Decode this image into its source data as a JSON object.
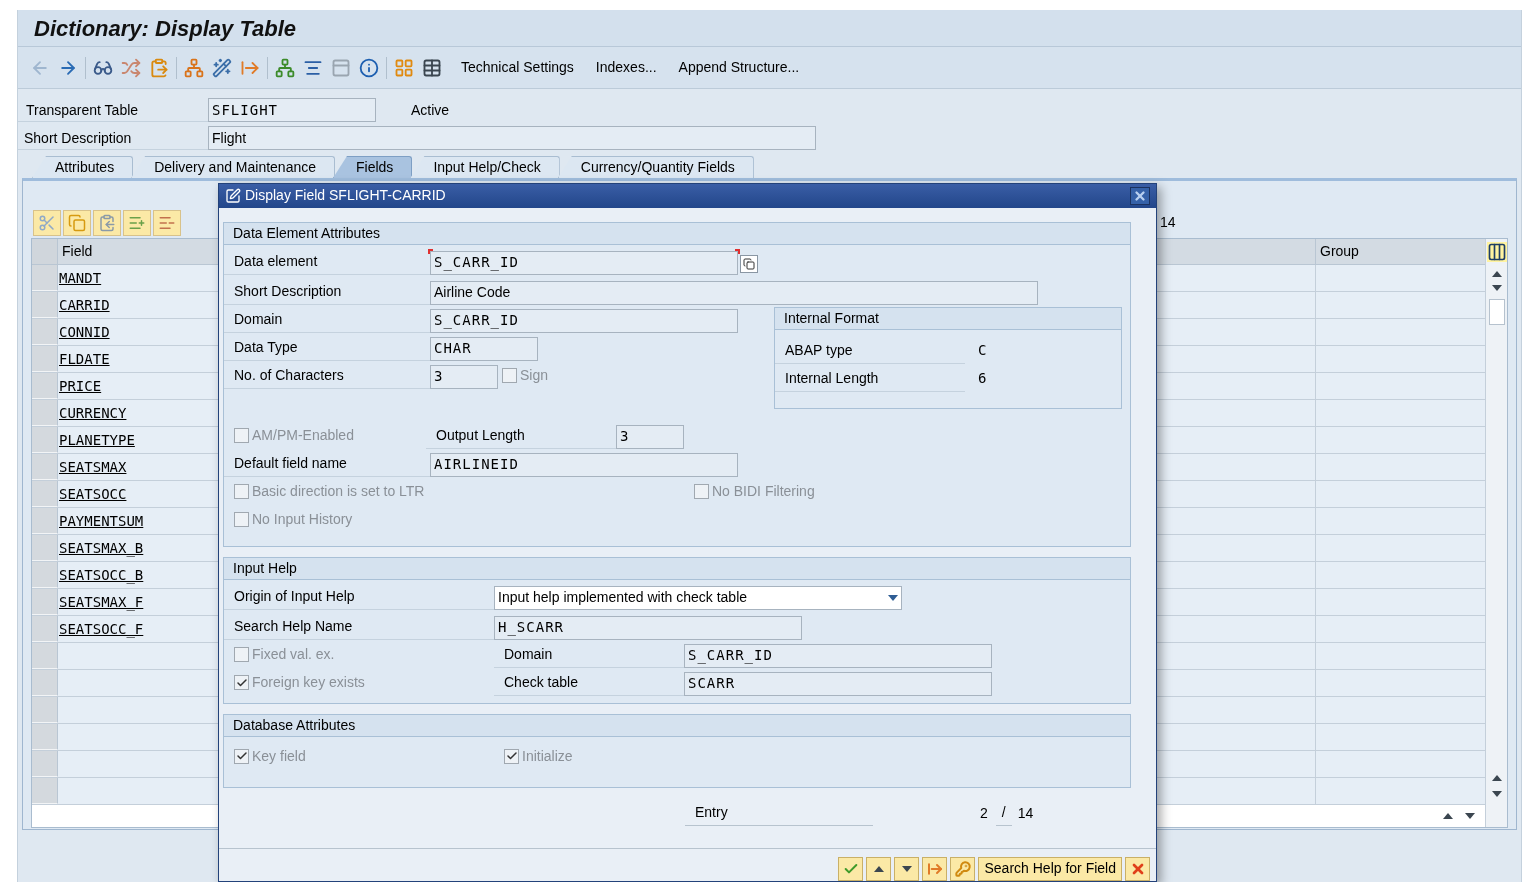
{
  "window": {
    "title": "Dictionary: Display Table"
  },
  "toolbar": {
    "buttons": [
      "Technical Settings",
      "Indexes...",
      "Append Structure..."
    ]
  },
  "header": {
    "table_label": "Transparent Table",
    "table_name": "SFLIGHT",
    "status": "Active",
    "description_label": "Short Description",
    "description": "Flight"
  },
  "tabs": [
    {
      "label": "Attributes",
      "selected": false
    },
    {
      "label": "Delivery and Maintenance",
      "selected": false
    },
    {
      "label": "Fields",
      "selected": true
    },
    {
      "label": "Input Help/Check",
      "selected": false
    },
    {
      "label": "Currency/Quantity Fields",
      "selected": false
    }
  ],
  "fields_table": {
    "entry_total": "14",
    "columns": [
      "Field",
      "Group"
    ],
    "rows": [
      "MANDT",
      "CARRID",
      "CONNID",
      "FLDATE",
      "PRICE",
      "CURRENCY",
      "PLANETYPE",
      "SEATSMAX",
      "SEATSOCC",
      "PAYMENTSUM",
      "SEATSMAX_B",
      "SEATSOCC_B",
      "SEATSMAX_F",
      "SEATSOCC_F"
    ]
  },
  "dialog": {
    "title": "Display Field SFLIGHT-CARRID",
    "data_element": {
      "title": "Data Element Attributes",
      "data_element": {
        "label": "Data element",
        "value": "S_CARR_ID"
      },
      "short_description": {
        "label": "Short Description",
        "value": "Airline Code"
      },
      "domain": {
        "label": "Domain",
        "value": "S_CARR_ID"
      },
      "data_type": {
        "label": "Data Type",
        "value": "CHAR"
      },
      "characters": {
        "label": "No. of Characters",
        "value": "3"
      },
      "sign": {
        "label": "Sign",
        "checked": false,
        "disabled": true
      },
      "internal_format": {
        "title": "Internal Format",
        "rows": [
          {
            "label": "ABAP type",
            "value": "C"
          },
          {
            "label": "Internal Length",
            "value": "6"
          }
        ]
      },
      "ampm": {
        "label": "AM/PM-Enabled",
        "checked": false,
        "disabled": true
      },
      "output_length": {
        "label": "Output Length",
        "value": "3"
      },
      "default_name": {
        "label": "Default field name",
        "value": "AIRLINEID"
      },
      "ltr": {
        "label": "Basic direction is set to LTR",
        "checked": false,
        "disabled": true
      },
      "bidi": {
        "label": "No BIDI Filtering",
        "checked": false,
        "disabled": true
      },
      "history": {
        "label": "No Input History",
        "checked": false,
        "disabled": true
      }
    },
    "input_help": {
      "title": "Input Help",
      "origin": {
        "label": "Origin of Input Help",
        "value": "Input help implemented with check table"
      },
      "search_help": {
        "label": "Search Help Name",
        "value": "H_SCARR"
      },
      "fixed": {
        "label": "Fixed val. ex.",
        "checked": false,
        "disabled": true
      },
      "domain": {
        "label": "Domain",
        "value": "S_CARR_ID"
      },
      "foreign": {
        "label": "Foreign key exists",
        "checked": true,
        "disabled": true
      },
      "check_table": {
        "label": "Check table",
        "value": "SCARR"
      }
    },
    "database": {
      "title": "Database Attributes",
      "key": {
        "label": "Key field",
        "checked": true,
        "disabled": true
      },
      "initialize": {
        "label": "Initialize",
        "checked": true,
        "disabled": true
      }
    },
    "entry": {
      "label": "Entry",
      "current": "2",
      "separator": "/",
      "total": "14"
    },
    "help_button": "Search Help for Field"
  }
}
